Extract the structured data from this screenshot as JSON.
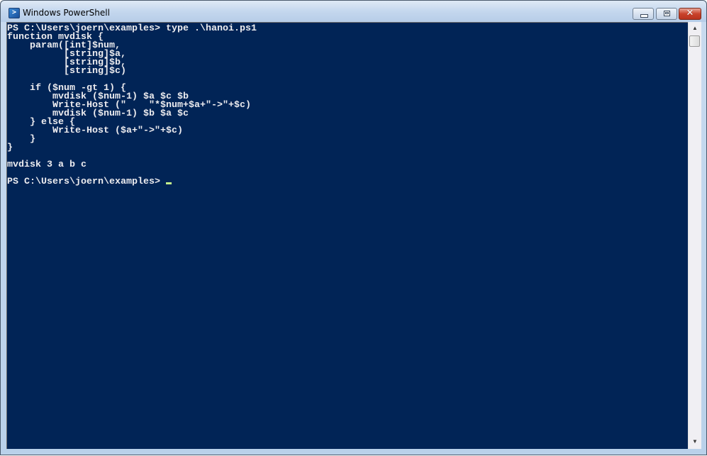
{
  "window": {
    "title": "Windows PowerShell",
    "icon": "powershell-icon",
    "icon_glyph": ">",
    "buttons": {
      "minimize_icon": "minimize-icon",
      "maximize_icon": "maximize-icon",
      "close_icon": "close-icon",
      "close_glyph": "✕"
    }
  },
  "console": {
    "background_color": "#012456",
    "foreground_color": "#eeedf0",
    "cursor_color": "#c4f08c",
    "lines": [
      "PS C:\\Users\\joern\\examples> type .\\hanoi.ps1",
      "function mvdisk {",
      "    param([int]$num,",
      "          [string]$a,",
      "          [string]$b,",
      "          [string]$c)",
      "",
      "    if ($num -gt 1) {",
      "        mvdisk ($num-1) $a $c $b",
      "        Write-Host (\"    \"*$num+$a+\"->\"+$c)",
      "        mvdisk ($num-1) $b $a $c",
      "    } else {",
      "        Write-Host ($a+\"->\"+$c)",
      "    }",
      "}",
      "",
      "mvdisk 3 a b c",
      ""
    ],
    "prompt": "PS C:\\Users\\joern\\examples> "
  },
  "scrollbar": {
    "up_glyph": "▲",
    "down_glyph": "▼",
    "position_fraction": 0
  }
}
